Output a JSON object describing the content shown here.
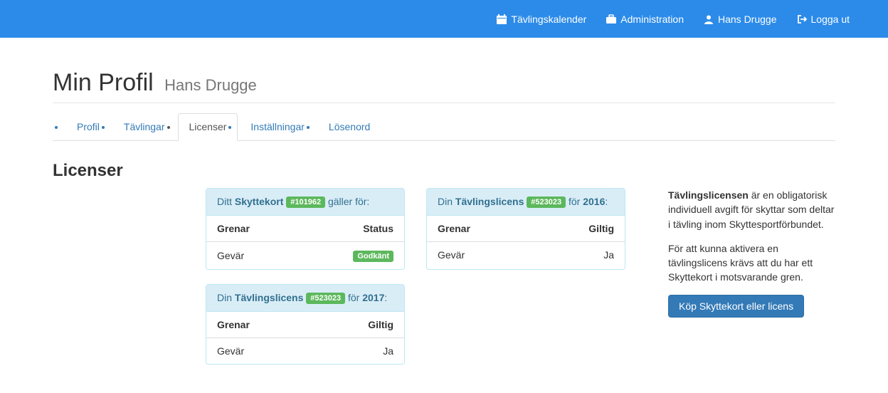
{
  "nav": {
    "calendar": "Tävlingskalender",
    "admin": "Administration",
    "user": "Hans Drugge",
    "logout": "Logga ut"
  },
  "header": {
    "title": "Min Profil",
    "subtitle": "Hans Drugge"
  },
  "tabs": {
    "profile": "Profil",
    "competitions": "Tävlingar",
    "licenses": "Licenser",
    "settings": "Inställningar",
    "password": "Lösenord"
  },
  "section_title": "Licenser",
  "panels": {
    "skyttekort": {
      "prefix": "Ditt ",
      "bold": "Skyttekort",
      "badge": "#101962",
      "suffix": " gäller för:",
      "col1": "Grenar",
      "col2": "Status",
      "row_label": "Gevär",
      "row_status": "Godkänt"
    },
    "license2016": {
      "prefix": "Din ",
      "bold": "Tävlingslicens",
      "badge": "#523023",
      "mid": " för ",
      "year": "2016",
      "suffix": ":",
      "col1": "Grenar",
      "col2": "Giltig",
      "row_label": "Gevär",
      "row_status": "Ja"
    },
    "license2017": {
      "prefix": "Din ",
      "bold": "Tävlingslicens",
      "badge": "#523023",
      "mid": " för ",
      "year": "2017",
      "suffix": ":",
      "col1": "Grenar",
      "col2": "Giltig",
      "row_label": "Gevär",
      "row_status": "Ja"
    }
  },
  "side": {
    "bold": "Tävlingslicensen",
    "p1_rest": " är en obligatorisk individuell avgift för skyttar som deltar i tävling inom Skyttesportförbundet.",
    "p2": "För att kunna aktivera en tävlingslicens krävs att du har ett Skyttekort i motsvarande gren.",
    "button": "Köp Skyttekort eller licens"
  }
}
